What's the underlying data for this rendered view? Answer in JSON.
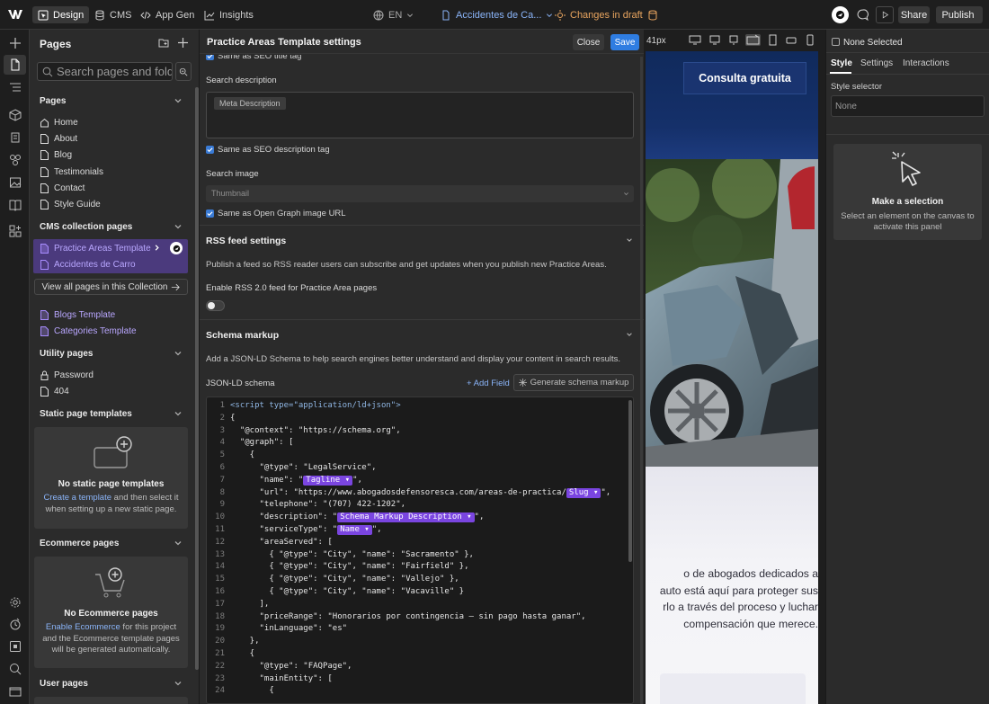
{
  "topbar": {
    "design": "Design",
    "cms": "CMS",
    "appgen": "App Gen",
    "insights": "Insights",
    "lang": "EN",
    "page": "Accidentes de Ca...",
    "draft": "Changes in draft",
    "share": "Share",
    "publish": "Publish"
  },
  "pages_panel": {
    "title": "Pages",
    "search_placeholder": "Search pages and folders",
    "sections": {
      "pages": "Pages",
      "cms": "CMS collection pages",
      "utility": "Utility pages",
      "static": "Static page templates",
      "ecommerce": "Ecommerce pages",
      "user": "User pages"
    },
    "static_pages": [
      "Home",
      "About",
      "Blog",
      "Testimonials",
      "Contact",
      "Style Guide"
    ],
    "cms_template": "Practice Areas Template",
    "cms_item": "Accidentes de Carro",
    "view_all": "View all pages in this Collection",
    "cms_templates": [
      "Blogs Template",
      "Categories Template"
    ],
    "utility_pages": [
      "Password",
      "404"
    ],
    "static_card": {
      "title": "No static page templates",
      "link": "Create a template",
      "text1": " and then select it",
      "text2": "when setting up a new static page."
    },
    "ecom_card": {
      "title": "No Ecommerce pages",
      "link": "Enable Ecommerce",
      "text1": " for this project",
      "text2": "and the Ecommerce template pages",
      "text3": "will be generated automatically."
    }
  },
  "modal": {
    "title": "Practice Areas Template settings",
    "close": "Close",
    "save": "Save",
    "seo_title_chk": "Same as SEO title tag",
    "search_desc_label": "Search description",
    "meta_desc_token": "Meta Description",
    "seo_desc_chk": "Same as SEO description tag",
    "search_image_label": "Search image",
    "thumbnail": "Thumbnail",
    "og_chk": "Same as Open Graph image URL",
    "rss": {
      "title": "RSS feed settings",
      "desc": "Publish a feed so RSS reader users can subscribe and get updates when you publish new Practice Areas.",
      "toggle_label": "Enable RSS 2.0 feed for Practice Area pages"
    },
    "schema": {
      "title": "Schema markup",
      "desc": "Add a JSON-LD Schema to help search engines better understand and display your content in search results.",
      "label": "JSON-LD schema",
      "add_field": "+ Add Field",
      "generate": "Generate schema markup"
    },
    "code_lines": [
      "<script type=\"application/ld+json\">",
      "{",
      "  \"@context\": \"https://schema.org\",",
      "  \"@graph\": [",
      "    {",
      "      \"@type\": \"LegalService\",",
      "      \"name\": \"[[Tagline]]\",",
      "      \"url\": \"https://www.abogadosdefensoresca.com/areas-de-practica/[[Slug]]\",",
      "      \"telephone\": \"(707) 422-1202\",",
      "      \"description\": \"[[Schema Markup Description]]\",",
      "      \"serviceType\": \"[[Name]]\",",
      "      \"areaServed\": [",
      "        { \"@type\": \"City\", \"name\": \"Sacramento\" },",
      "        { \"@type\": \"City\", \"name\": \"Fairfield\" },",
      "        { \"@type\": \"City\", \"name\": \"Vallejo\" },",
      "        { \"@type\": \"City\", \"name\": \"Vacaville\" }",
      "      ],",
      "      \"priceRange\": \"Honorarios por contingencia – sin pago hasta ganar\",",
      "      \"inLanguage\": \"es\"",
      "    },",
      "    {",
      "      \"@type\": \"FAQPage\",",
      "      \"mainEntity\": [",
      "        {"
    ]
  },
  "canvas": {
    "width_label": "41px",
    "cta": "Consulta gratuita",
    "para": [
      "o de abogados dedicados a",
      "auto está aquí para proteger sus",
      "rlo a través del proceso y luchar",
      "compensación que merece."
    ]
  },
  "right_panel": {
    "none_selected": "None Selected",
    "tabs": [
      "Style",
      "Settings",
      "Interactions"
    ],
    "style_selector": "Style selector",
    "selector_value": "None",
    "make_selection": "Make a selection",
    "make_desc1": "Select an element on the canvas to",
    "make_desc2": "activate this panel"
  },
  "colors": {
    "accent": "#3a7bd5",
    "cms_purple": "#7a45e0",
    "draft": "#e9a55f",
    "site_navy": "#15306a"
  }
}
